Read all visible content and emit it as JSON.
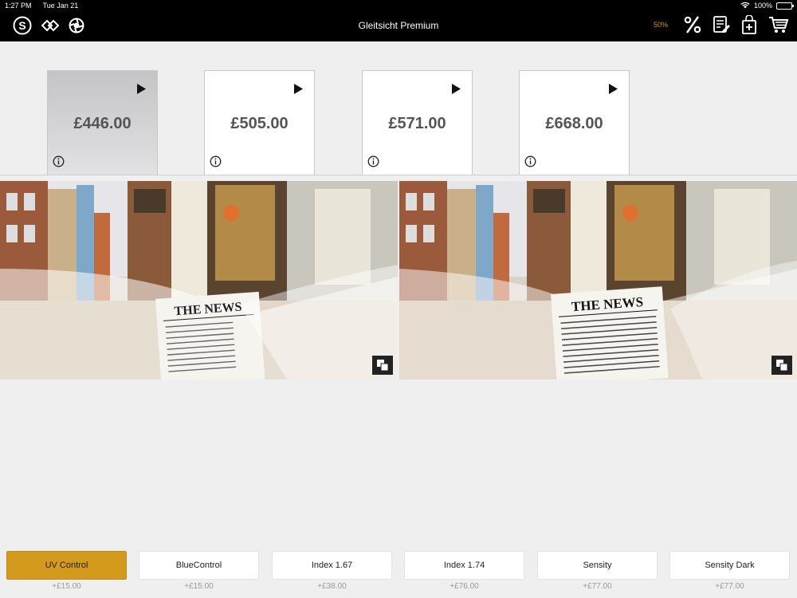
{
  "status_bar": {
    "time": "1:27 PM",
    "date": "Tue Jan 21",
    "battery": "100%"
  },
  "header": {
    "title": "Gleitsicht Premium",
    "discount_indicator": "50%",
    "left_icons": [
      "s-logo-icon",
      "double-chevron-icon",
      "aperture-icon"
    ],
    "right_icons": [
      "percent-icon",
      "notes-icon",
      "bag-add-icon",
      "cart-icon"
    ]
  },
  "price_options": [
    {
      "price": "£446.00",
      "selected": true
    },
    {
      "price": "£505.00",
      "selected": false
    },
    {
      "price": "£571.00",
      "selected": false
    },
    {
      "price": "£668.00",
      "selected": false
    }
  ],
  "compare_panels": [
    {
      "headline": "THE NEWS"
    },
    {
      "headline": "THE NEWS"
    }
  ],
  "addons": [
    {
      "label": "UV Control",
      "price": "+£15.00",
      "selected": true
    },
    {
      "label": "BlueControl",
      "price": "+£15.00",
      "selected": false
    },
    {
      "label": "Index 1.67",
      "price": "+£38.00",
      "selected": false
    },
    {
      "label": "Index 1.74",
      "price": "+£76.00",
      "selected": false
    },
    {
      "label": "Sensity",
      "price": "+£77.00",
      "selected": false
    },
    {
      "label": "Sensity Dark",
      "price": "+£77.00",
      "selected": false
    }
  ],
  "colors": {
    "accent": "#d49a1e",
    "header_bg": "#000000",
    "discount": "#d69a00"
  }
}
